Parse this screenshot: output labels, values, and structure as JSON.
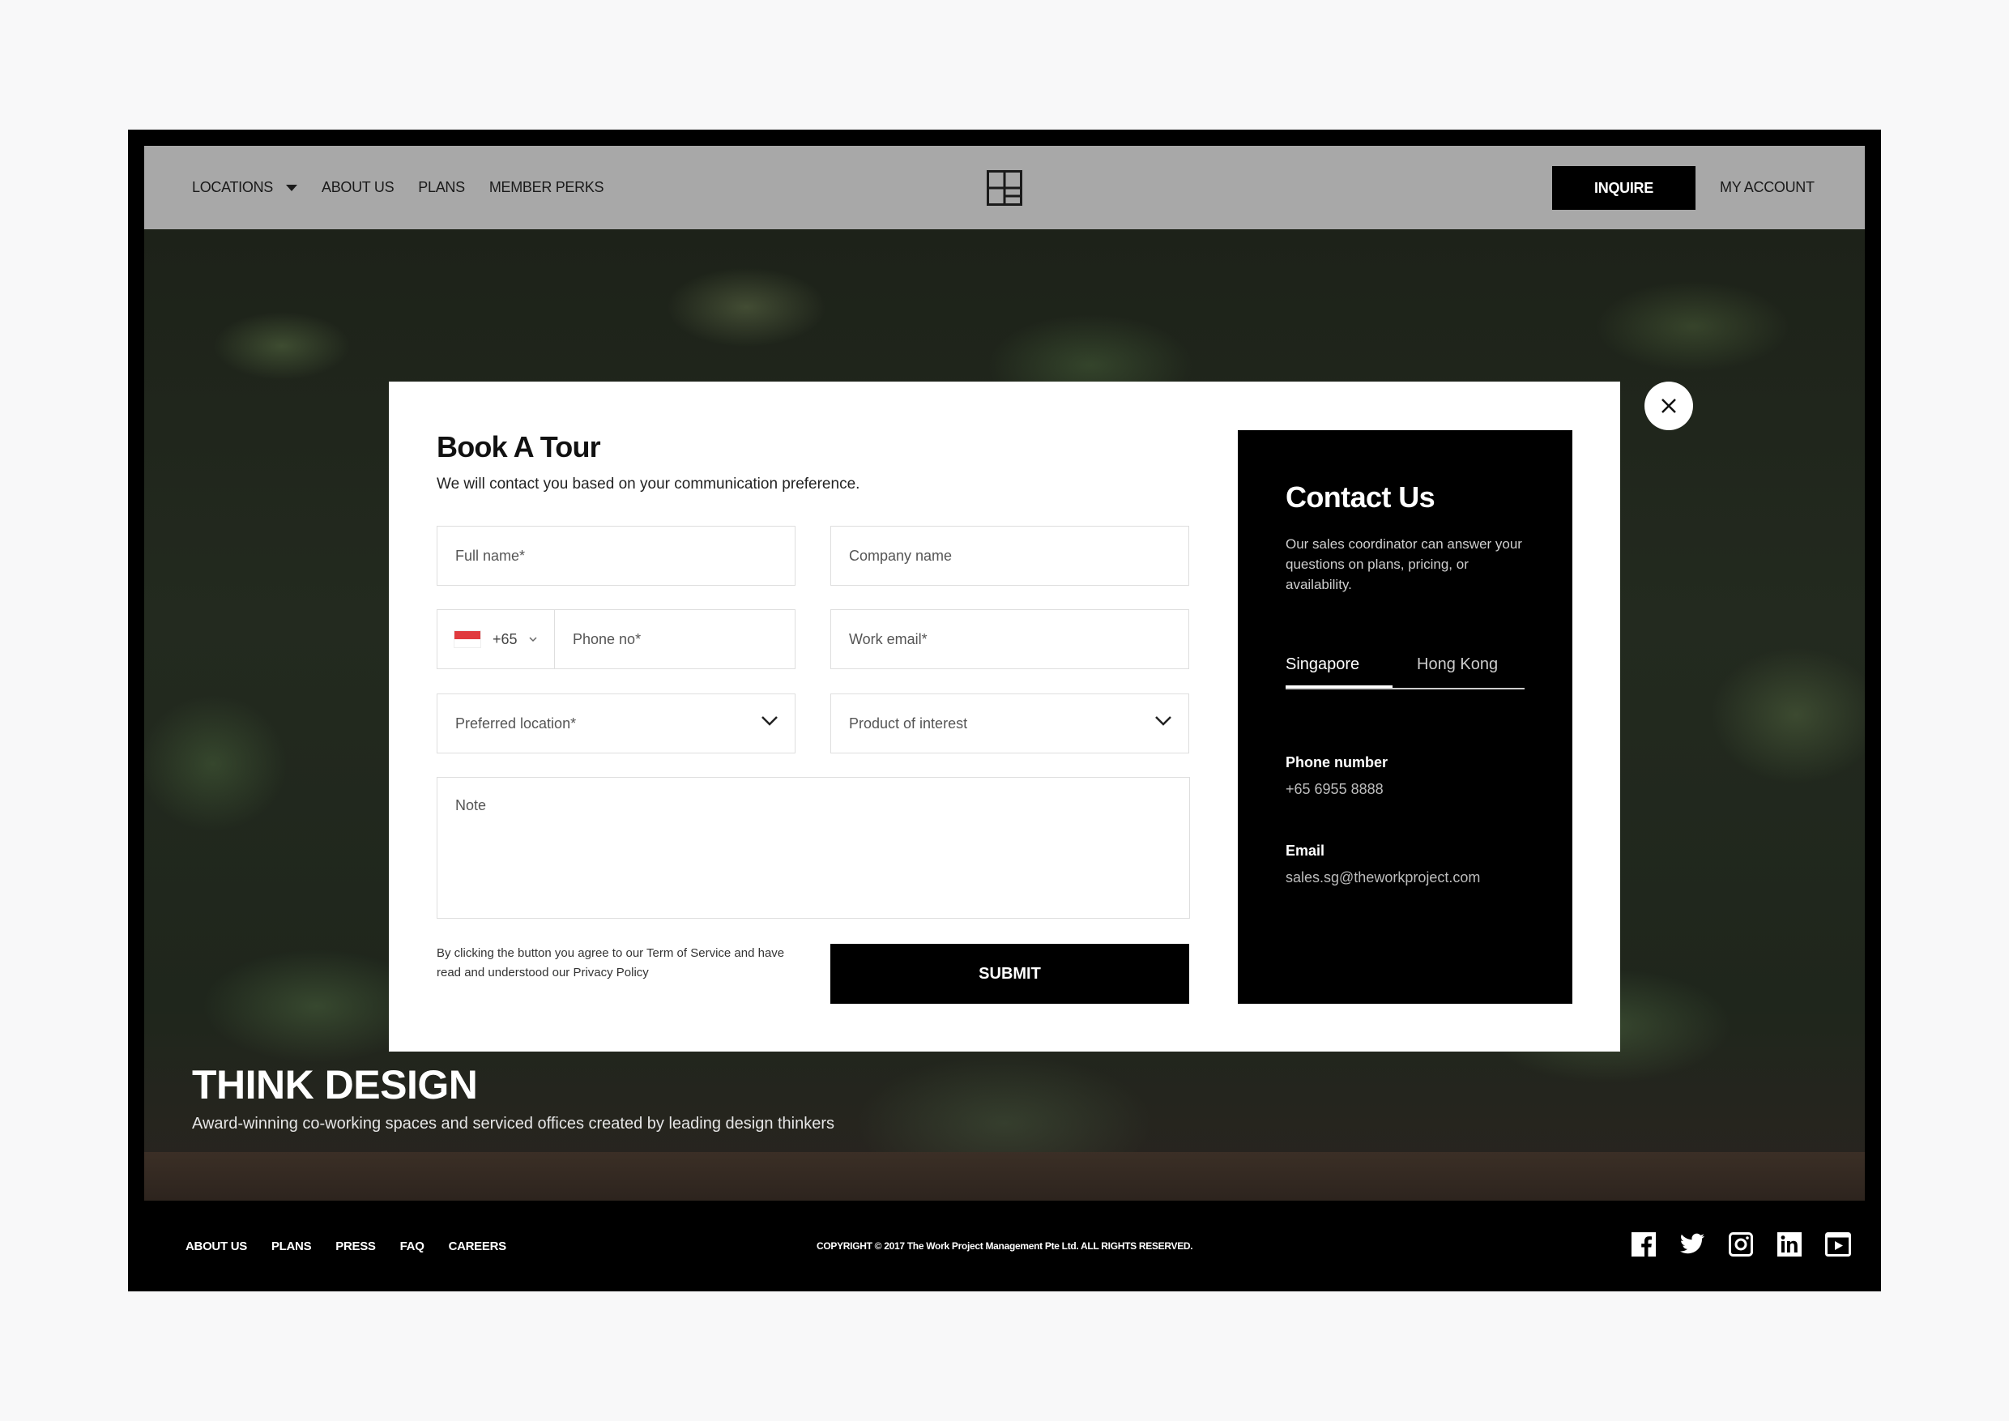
{
  "nav": {
    "items": [
      {
        "label": "LOCATIONS",
        "has_caret": true
      },
      {
        "label": "ABOUT US"
      },
      {
        "label": "PLANS"
      },
      {
        "label": "MEMBER PERKS"
      }
    ],
    "inquire_label": "INQUIRE",
    "account_label": "MY ACCOUNT"
  },
  "hero": {
    "title": "THINK DESIGN",
    "subtitle": "Award-winning co-working spaces and serviced offices created by leading design thinkers"
  },
  "form": {
    "title": "Book A Tour",
    "subtitle": "We will contact you based on your communication preference.",
    "full_name_placeholder": "Full name*",
    "company_placeholder": "Company name",
    "country_code": "+65",
    "phone_placeholder": "Phone no*",
    "email_placeholder": "Work email*",
    "location_placeholder": "Preferred location*",
    "product_placeholder": "Product of interest",
    "note_placeholder": "Note",
    "terms": "By clicking the button you agree to our Term of Service and have read and understood our Privacy Policy",
    "submit_label": "SUBMIT"
  },
  "contact": {
    "title": "Contact Us",
    "description": "Our sales coordinator can answer your questions on plans, pricing, or availability.",
    "tabs": [
      "Singapore",
      "Hong Kong"
    ],
    "active_tab": "Singapore",
    "phone_label": "Phone number",
    "phone_value": "+65 6955 8888",
    "email_label": "Email",
    "email_value": "sales.sg@theworkproject.com"
  },
  "footer": {
    "links": [
      "ABOUT US",
      "PLANS",
      "PRESS",
      "FAQ",
      "CAREERS"
    ],
    "copyright": "COPYRIGHT © 2017 The Work Project Management Pte Ltd. ALL RIGHTS RESERVED.",
    "social_icons": [
      "facebook-icon",
      "twitter-icon",
      "instagram-icon",
      "linkedin-icon",
      "youtube-icon"
    ]
  },
  "colors": {
    "nav_bg": "#a8a8a8",
    "accent": "#000000",
    "flag_red": "#e03a3e"
  }
}
